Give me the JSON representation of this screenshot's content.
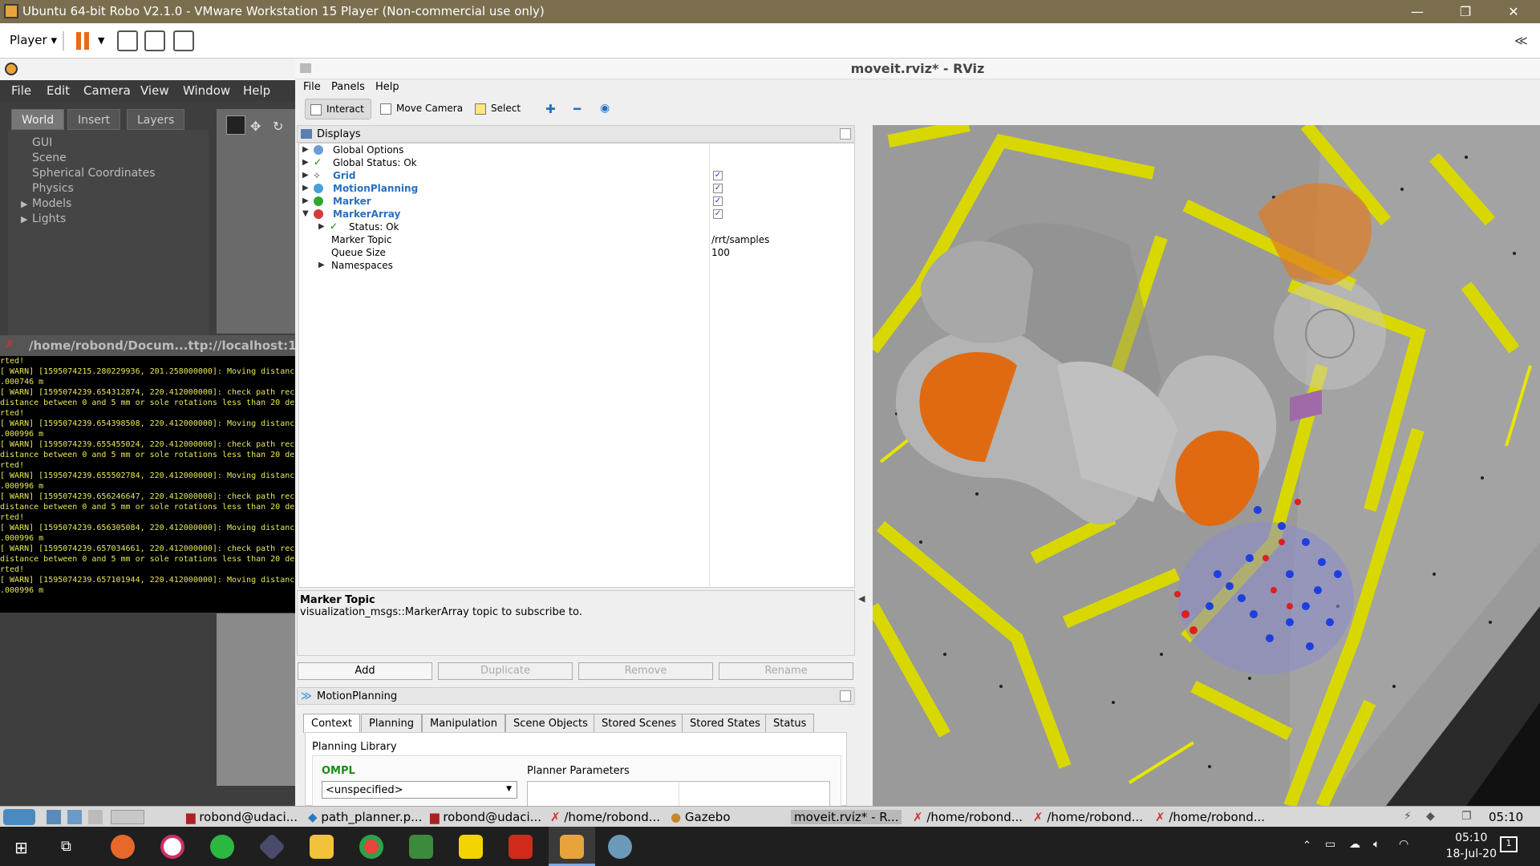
{
  "window": {
    "title": "Ubuntu 64-bit Robo V2.1.0 - VMware Workstation 15 Player (Non-commercial use only)",
    "minimize": "—",
    "restore": "❐",
    "close": "✕"
  },
  "vmware_toolbar": {
    "player_menu": "Player",
    "collapse": "≪"
  },
  "gazebo": {
    "menu": [
      "File",
      "Edit",
      "Camera",
      "View",
      "Window",
      "Help"
    ],
    "tabs": [
      "World",
      "Insert",
      "Layers"
    ],
    "tree": [
      "GUI",
      "Scene",
      "Spherical Coordinates",
      "Physics",
      "Models",
      "Lights"
    ]
  },
  "terminal": {
    "title": "/home/robond/Docum...ttp://localhost:1",
    "lines": [
      "rted!",
      "[ WARN] [1595074215.280229936, 201.258000000]: Moving distanc",
      ".000746 m",
      "[ WARN] [1595074239.654312874, 220.412000000]: check path rec",
      "distance between 0 and 5 mm or sole rotations less than 20 de",
      "rted!",
      "[ WARN] [1595074239.654398508, 220.412000000]: Moving distanc",
      ".000996 m",
      "[ WARN] [1595074239.655455024, 220.412000000]: check path rec",
      "distance between 0 and 5 mm or sole rotations less than 20 de",
      "rted!",
      "[ WARN] [1595074239.655502784, 220.412000000]: Moving distanc",
      ".000996 m",
      "[ WARN] [1595074239.656246647, 220.412000000]: check path rec",
      "distance between 0 and 5 mm or sole rotations less than 20 de",
      "rted!",
      "[ WARN] [1595074239.656305084, 220.412000000]: Moving distanc",
      ".000996 m",
      "[ WARN] [1595074239.657034661, 220.412000000]: check path rec",
      "distance between 0 and 5 mm or sole rotations less than 20 de",
      "rted!",
      "[ WARN] [1595074239.657101944, 220.412000000]: Moving distanc",
      ".000996 m"
    ]
  },
  "rviz": {
    "title": "moveit.rviz* - RViz",
    "menu": [
      "File",
      "Panels",
      "Help"
    ],
    "tools": [
      "Interact",
      "Move Camera",
      "Select"
    ],
    "displays_title": "Displays",
    "displays": [
      {
        "label": "Global Options"
      },
      {
        "label": "Global Status: Ok"
      },
      {
        "label": "Grid"
      },
      {
        "label": "MotionPlanning"
      },
      {
        "label": "Marker"
      },
      {
        "label": "MarkerArray"
      },
      {
        "label": "Status: Ok"
      },
      {
        "label": "Marker Topic",
        "value": "/rrt/samples"
      },
      {
        "label": "Queue Size",
        "value": "100"
      },
      {
        "label": "Namespaces"
      }
    ],
    "check_mark": "✓",
    "description": {
      "title": "Marker Topic",
      "text": "visualization_msgs::MarkerArray topic to subscribe to."
    },
    "buttons": [
      "Add",
      "Duplicate",
      "Remove",
      "Rename"
    ],
    "motion_planning": {
      "title": "MotionPlanning",
      "tabs": [
        "Context",
        "Planning",
        "Manipulation",
        "Scene Objects",
        "Stored Scenes",
        "Stored States",
        "Status"
      ],
      "planning_library": "Planning Library",
      "ompl": "OMPL",
      "planner": "<unspecified>",
      "planner_parameters": "Planner Parameters"
    }
  },
  "guest_taskbar": {
    "items": [
      "robond@udaci...",
      "path_planner.p...",
      "robond@udaci...",
      "/home/robond...",
      "Gazebo",
      "moveit.rviz* - R...",
      "/home/robond...",
      "/home/robond...",
      "/home/robond..."
    ],
    "time": "05:10"
  },
  "windows_taskbar": {
    "time": "05:10",
    "date": "18-Jul-20",
    "notifications": "1"
  }
}
